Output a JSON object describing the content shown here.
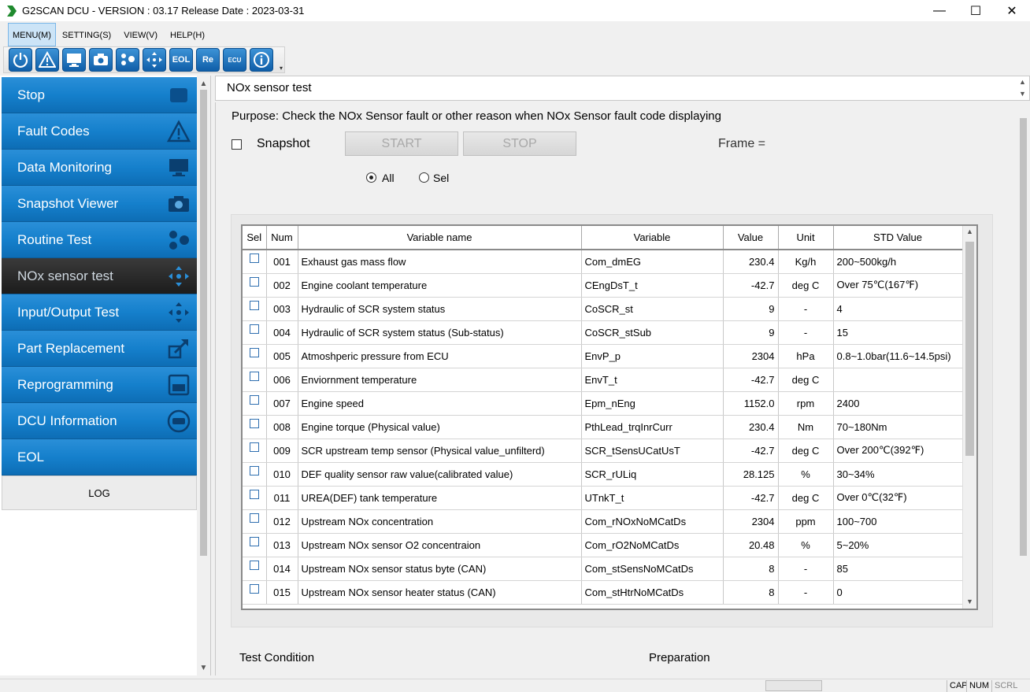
{
  "window": {
    "title": "G2SCAN DCU - VERSION : 03.17 Release Date : 2023-03-31",
    "minimize": "—",
    "maximize": "☐",
    "close": "✕"
  },
  "menu": [
    {
      "label": "MENU(M)"
    },
    {
      "label": "SETTING(S)"
    },
    {
      "label": "VIEW(V)"
    },
    {
      "label": "HELP(H)"
    }
  ],
  "toolbar": {
    "eol_label": "EOL",
    "re_label": "Re",
    "ecu_label": "ECU",
    "more": "▾"
  },
  "sidebar": {
    "items": [
      {
        "label": "Stop",
        "icon": "stop-icon"
      },
      {
        "label": "Fault Codes",
        "icon": "warning-icon"
      },
      {
        "label": "Data Monitoring",
        "icon": "monitor-icon"
      },
      {
        "label": "Snapshot Viewer",
        "icon": "camera-icon"
      },
      {
        "label": "Routine Test",
        "icon": "routine-icon"
      },
      {
        "label": "NOx sensor test",
        "icon": "nox-icon"
      },
      {
        "label": "Input/Output Test",
        "icon": "io-icon"
      },
      {
        "label": "Part Replacement",
        "icon": "part-icon"
      },
      {
        "label": "Reprogramming",
        "icon": "reprogram-icon"
      },
      {
        "label": "DCU Information",
        "icon": "ecu-icon"
      },
      {
        "label": "EOL",
        "icon": ""
      }
    ],
    "log_label": "LOG"
  },
  "main": {
    "title": "NOx sensor test",
    "purpose": "Purpose: Check the NOx Sensor fault or other reason when NOx Sensor fault code displaying",
    "snapshot_label": "Snapshot",
    "start_label": "START",
    "stop_label": "STOP",
    "frame_label": "Frame =",
    "radio_all": "All",
    "radio_sel": "Sel",
    "test_condition": "Test Condition",
    "preparation": "Preparation"
  },
  "table": {
    "columns": [
      "Sel",
      "Num",
      "Variable name",
      "Variable",
      "Value",
      "Unit",
      "STD Value"
    ],
    "rows": [
      [
        "001",
        "Exhaust gas mass flow",
        "Com_dmEG",
        "230.4",
        "Kg/h",
        "200~500kg/h"
      ],
      [
        "002",
        "Engine coolant temperature",
        "CEngDsT_t",
        "-42.7",
        "deg C",
        "Over 75℃(167℉)"
      ],
      [
        "003",
        "Hydraulic of SCR system status",
        "CoSCR_st",
        "9",
        "-",
        "4"
      ],
      [
        "004",
        "Hydraulic of SCR system status (Sub-status)",
        "CoSCR_stSub",
        "9",
        "-",
        "15"
      ],
      [
        "005",
        "Atmoshperic pressure from ECU",
        "EnvP_p",
        "2304",
        "hPa",
        "0.8~1.0bar(11.6~14.5psi)"
      ],
      [
        "006",
        "Enviornment temperature",
        "EnvT_t",
        "-42.7",
        "deg C",
        ""
      ],
      [
        "007",
        "Engine speed",
        "Epm_nEng",
        "1152.0",
        "rpm",
        "2400"
      ],
      [
        "008",
        "Engine torque (Physical value)",
        "PthLead_trqInrCurr",
        "230.4",
        "Nm",
        "70~180Nm"
      ],
      [
        "009",
        "SCR upstream temp sensor (Physical value_unfilterd)",
        "SCR_tSensUCatUsT",
        "-42.7",
        "deg C",
        "Over 200℃(392℉)"
      ],
      [
        "010",
        "DEF quality sensor raw value(calibrated value)",
        "SCR_rULiq",
        "28.125",
        "%",
        "30~34%"
      ],
      [
        "011",
        "UREA(DEF) tank temperature",
        "UTnkT_t",
        "-42.7",
        "deg C",
        "Over 0℃(32℉)"
      ],
      [
        "012",
        "Upstream NOx concentration",
        "Com_rNOxNoMCatDs",
        "2304",
        "ppm",
        "100~700"
      ],
      [
        "013",
        "Upstream NOx sensor O2 concentraion",
        "Com_rO2NoMCatDs",
        "20.48",
        "%",
        "5~20%"
      ],
      [
        "014",
        "Upstream NOx sensor status byte (CAN)",
        "Com_stSensNoMCatDs",
        "8",
        "-",
        "85"
      ],
      [
        "015",
        "Upstream NOx sensor heater status (CAN)",
        "Com_stHtrNoMCatDs",
        "8",
        "-",
        "0"
      ]
    ]
  },
  "status": {
    "cap": "CAP",
    "num": "NUM",
    "scrl": "SCRL"
  },
  "colors": {
    "nav_blue": "#1580cc",
    "nav_active": "#262626",
    "toolbar_blue": "#0f5ea8"
  }
}
